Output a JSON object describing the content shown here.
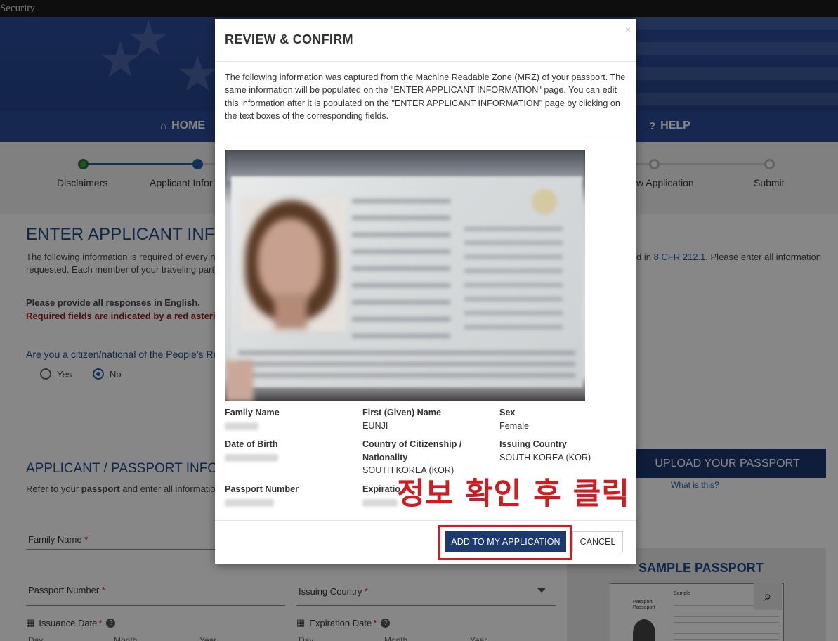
{
  "topbar": {
    "text": "l Security"
  },
  "nav": {
    "home": "HOME",
    "help": "HELP"
  },
  "steps": [
    {
      "label": "Disclaimers"
    },
    {
      "label": "Applicant Infor"
    },
    {
      "label": "w Application"
    },
    {
      "label": "Submit"
    }
  ],
  "page": {
    "title": "ENTER APPLICANT INFO",
    "intro_line1_a": "The following information is required of every n",
    "intro_line1_b": "d in ",
    "cfr_link": "8 CFR 212.1",
    "intro_line1_c": ". Please enter all information",
    "intro_line2": "requested. Each member of your traveling party",
    "english_note": "Please provide all responses in English.",
    "required_note": "Required fields are indicated by a red asterisk",
    "citizen_question": "Are you a citizen/national of the People's Re",
    "radio_yes": "Yes",
    "radio_no": "No",
    "section_title": "APPLICANT / PASSPORT INFO",
    "section_sub_a": "Refer to your ",
    "section_sub_b": "passport",
    "section_sub_c": " and enter all information",
    "field_family_name": "Family Name",
    "field_passport_number": "Passport Number",
    "field_issuing_country": "Issuing Country",
    "asterisk": "*",
    "issuance_date": "Issuance Date",
    "expiration_date": "Expiration Date",
    "day": "Day",
    "month": "Month",
    "year": "Year",
    "upload_button": "UPLOAD YOUR PASSPORT",
    "what_is_this": "What is this?",
    "sample_title": "SAMPLE PASSPORT",
    "sample_word": "Sample",
    "sample_passport": "Passport\nPasseport"
  },
  "modal": {
    "title": "REVIEW & CONFIRM",
    "close": "×",
    "description": "The following information was captured from the Machine Readable Zone (MRZ) of your passport. The same information will be populated on the \"ENTER APPLICANT INFORMATION\" page. You can edit this information after it is populated on the \"ENTER APPLICANT INFORMATION\" page by clicking on the text boxes of the corresponding fields.",
    "fields": {
      "family_name_label": "Family Name",
      "first_name_label": "First (Given) Name",
      "first_name_value": "EUNJI",
      "sex_label": "Sex",
      "sex_value": "Female",
      "dob_label": "Date of Birth",
      "citizenship_label_1": "Country of Citizenship /",
      "citizenship_label_2": "Nationality",
      "citizenship_value": "SOUTH KOREA (KOR)",
      "issuing_label": "Issuing Country",
      "issuing_value": "SOUTH KOREA (KOR)",
      "passport_number_label": "Passport Number",
      "expiration_label": "Expiratio"
    },
    "add_button": "ADD TO MY APPLICATION",
    "cancel_button": "CANCEL"
  },
  "annotation": {
    "text": "정보 확인 후 클릭",
    "color": "#d4191f"
  },
  "colors": {
    "primary": "#1c3a6e",
    "link": "#1f5fa8",
    "heading": "#1f4a87",
    "required": "#a01818"
  }
}
